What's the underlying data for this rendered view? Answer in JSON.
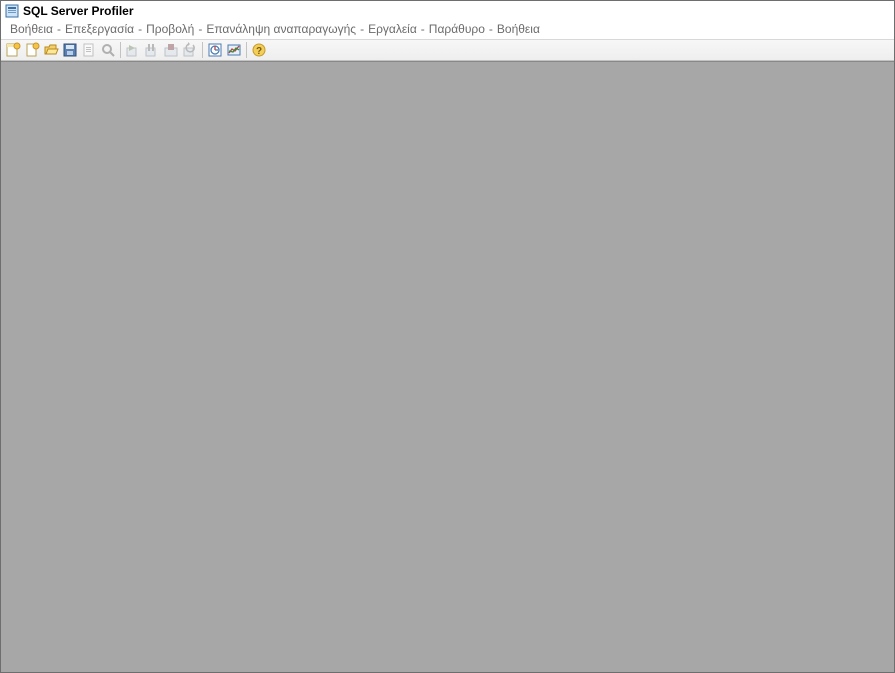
{
  "window": {
    "title": "SQL Server Profiler"
  },
  "menu": {
    "items": [
      "Βοήθεια",
      "Επεξεργασία",
      "Προβολή",
      "Επανάληψη αναπαραγωγής",
      "Εργαλεία",
      "Παράθυρο",
      "Βοήθεια"
    ],
    "separator": "-"
  },
  "toolbar": {
    "buttons": [
      {
        "name": "new-trace",
        "enabled": true
      },
      {
        "name": "new-template",
        "enabled": true
      },
      {
        "name": "open-file",
        "enabled": true
      },
      {
        "name": "save",
        "enabled": true
      },
      {
        "name": "properties",
        "enabled": false
      },
      {
        "name": "find",
        "enabled": false
      },
      {
        "name": "sep",
        "enabled": true
      },
      {
        "name": "start",
        "enabled": false
      },
      {
        "name": "pause",
        "enabled": false
      },
      {
        "name": "stop",
        "enabled": false
      },
      {
        "name": "replay",
        "enabled": false
      },
      {
        "name": "sep",
        "enabled": true
      },
      {
        "name": "tuning",
        "enabled": true
      },
      {
        "name": "performance",
        "enabled": true
      },
      {
        "name": "sep",
        "enabled": true
      },
      {
        "name": "help",
        "enabled": true
      }
    ]
  }
}
